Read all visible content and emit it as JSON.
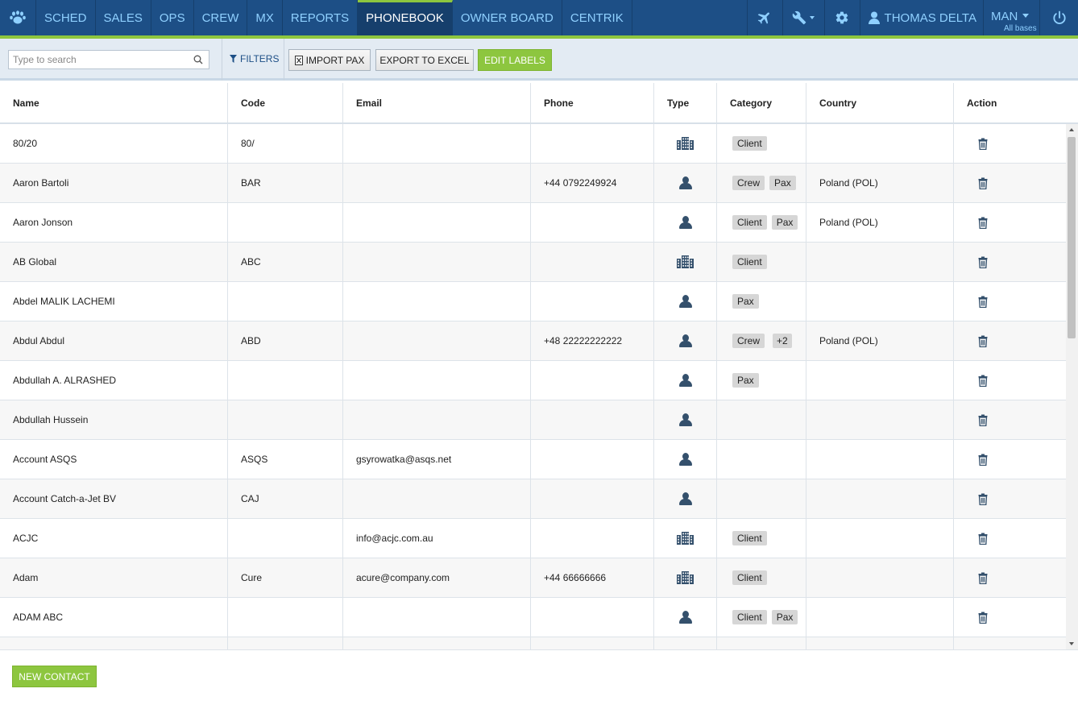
{
  "nav": {
    "items": [
      {
        "id": "sched",
        "label": "SCHED"
      },
      {
        "id": "sales",
        "label": "SALES"
      },
      {
        "id": "ops",
        "label": "OPS"
      },
      {
        "id": "crew",
        "label": "CREW"
      },
      {
        "id": "mx",
        "label": "MX"
      },
      {
        "id": "reports",
        "label": "REPORTS"
      },
      {
        "id": "phonebook",
        "label": "PHONEBOOK",
        "active": true
      },
      {
        "id": "owner-board",
        "label": "OWNER BOARD"
      },
      {
        "id": "centrik",
        "label": "CENTRIK"
      }
    ],
    "user_name": "THOMAS DELTA",
    "base_name": "MAN",
    "base_sub": "All bases",
    "icons": {
      "logo": "paw-icon",
      "flight": "airplane-icon",
      "tools": "wrench-icon",
      "settings": "gear-icon",
      "user": "user-icon",
      "power": "power-icon"
    }
  },
  "toolbar": {
    "search_placeholder": "Type to search",
    "search_value": "",
    "filters_label": "FILTERS",
    "import_label": "IMPORT PAX",
    "export_label": "EXPORT TO EXCEL",
    "edit_labels_label": "EDIT LABELS"
  },
  "table": {
    "columns": [
      "Name",
      "Code",
      "Email",
      "Phone",
      "Type",
      "Category",
      "Country",
      "Action"
    ],
    "rows": [
      {
        "name": "80/20",
        "code": "80/",
        "email": "",
        "phone": "",
        "type": "company",
        "categories": [
          "Client"
        ],
        "more": "",
        "country": ""
      },
      {
        "name": "Aaron Bartoli",
        "code": "BAR",
        "email": "",
        "phone": "+44 0792249924",
        "type": "person",
        "categories": [
          "Crew",
          "Pax"
        ],
        "more": "",
        "country": "Poland (POL)"
      },
      {
        "name": "Aaron Jonson",
        "code": "",
        "email": "",
        "phone": "",
        "type": "person",
        "categories": [
          "Client",
          "Pax"
        ],
        "more": "",
        "country": "Poland (POL)"
      },
      {
        "name": "AB Global",
        "code": "ABC",
        "email": "",
        "phone": "",
        "type": "company",
        "categories": [
          "Client"
        ],
        "more": "",
        "country": ""
      },
      {
        "name": "Abdel MALIK LACHEMI",
        "code": "",
        "email": "",
        "phone": "",
        "type": "person",
        "categories": [
          "Pax"
        ],
        "more": "",
        "country": ""
      },
      {
        "name": "Abdul Abdul",
        "code": "ABD",
        "email": "",
        "phone": "+48 22222222222",
        "type": "person",
        "categories": [
          "Crew"
        ],
        "more": "+2",
        "country": "Poland (POL)"
      },
      {
        "name": "Abdullah A. ALRASHED",
        "code": "",
        "email": "",
        "phone": "",
        "type": "person",
        "categories": [
          "Pax"
        ],
        "more": "",
        "country": ""
      },
      {
        "name": "Abdullah Hussein",
        "code": "",
        "email": "",
        "phone": "",
        "type": "person",
        "categories": [],
        "more": "",
        "country": ""
      },
      {
        "name": "Account ASQS",
        "code": "ASQS",
        "email": "gsyrowatka@asqs.net",
        "phone": "",
        "type": "person",
        "categories": [],
        "more": "",
        "country": ""
      },
      {
        "name": "Account Catch-a-Jet BV",
        "code": "CAJ",
        "email": "",
        "phone": "",
        "type": "person",
        "categories": [],
        "more": "",
        "country": ""
      },
      {
        "name": "ACJC",
        "code": "",
        "email": "info@acjc.com.au",
        "phone": "",
        "type": "company",
        "categories": [
          "Client"
        ],
        "more": "",
        "country": ""
      },
      {
        "name": "Adam",
        "code": "Cure",
        "email": "acure@company.com",
        "phone": "+44 66666666",
        "type": "company",
        "categories": [
          "Client"
        ],
        "more": "",
        "country": ""
      },
      {
        "name": "ADAM ABC",
        "code": "",
        "email": "",
        "phone": "",
        "type": "person",
        "categories": [
          "Client",
          "Pax"
        ],
        "more": "",
        "country": ""
      },
      {
        "name": "",
        "code": "",
        "email": "",
        "phone": "",
        "type": "",
        "categories": [],
        "more": "",
        "country": ""
      }
    ]
  },
  "footer": {
    "new_contact_label": "NEW CONTACT"
  },
  "colors": {
    "nav_bg": "#1d4f86",
    "accent_green": "#8dc63f",
    "nav_text": "#8fd0ff",
    "icon_dark": "#34506c"
  }
}
